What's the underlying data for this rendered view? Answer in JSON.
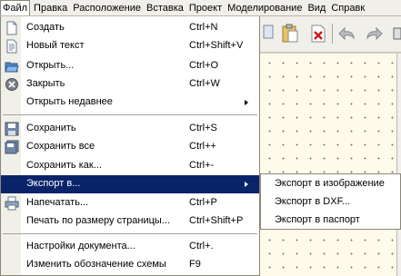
{
  "menubar": {
    "items": [
      "Файл",
      "Правка",
      "Расположение",
      "Вставка",
      "Проект",
      "Моделирование",
      "Вид",
      "Справк"
    ]
  },
  "file_menu": {
    "items": [
      {
        "label": "Создать",
        "shortcut": "Ctrl+N",
        "icon": "new-document-icon"
      },
      {
        "label": "Новый текст",
        "shortcut": "Ctrl+Shift+V",
        "icon": "new-text-icon"
      },
      {
        "label": "Открыть...",
        "shortcut": "Ctrl+O",
        "icon": "open-folder-icon"
      },
      {
        "label": "Закрыть",
        "shortcut": "Ctrl+W",
        "icon": "close-icon"
      },
      {
        "label": "Открыть недавнее",
        "shortcut": "",
        "icon": "",
        "submenu": true
      },
      {
        "label": "Сохранить",
        "shortcut": "Ctrl+S",
        "icon": "save-icon"
      },
      {
        "label": "Сохранить все",
        "shortcut": "Ctrl++",
        "icon": "save-all-icon"
      },
      {
        "label": "Сохранить как...",
        "shortcut": "Ctrl+-",
        "icon": ""
      },
      {
        "label": "Экспорт в...",
        "shortcut": "",
        "icon": "",
        "submenu": true,
        "highlighted": true
      },
      {
        "label": "Напечатать...",
        "shortcut": "Ctrl+P",
        "icon": "print-icon"
      },
      {
        "label": "Печать по размеру страницы...",
        "shortcut": "Ctrl+Shift+P",
        "icon": ""
      },
      {
        "label": "Настройки документа...",
        "shortcut": "Ctrl+.",
        "icon": ""
      },
      {
        "label": "Изменить обозначение схемы",
        "shortcut": "F9",
        "icon": ""
      }
    ]
  },
  "export_submenu": {
    "items": [
      "Экспорт в изображение",
      "Экспорт в DXF...",
      "Экспорт в паспорт"
    ]
  },
  "colors": {
    "highlight": "#0a246a",
    "canvas": "#fefbea",
    "menu_bg": "#ffffff"
  }
}
